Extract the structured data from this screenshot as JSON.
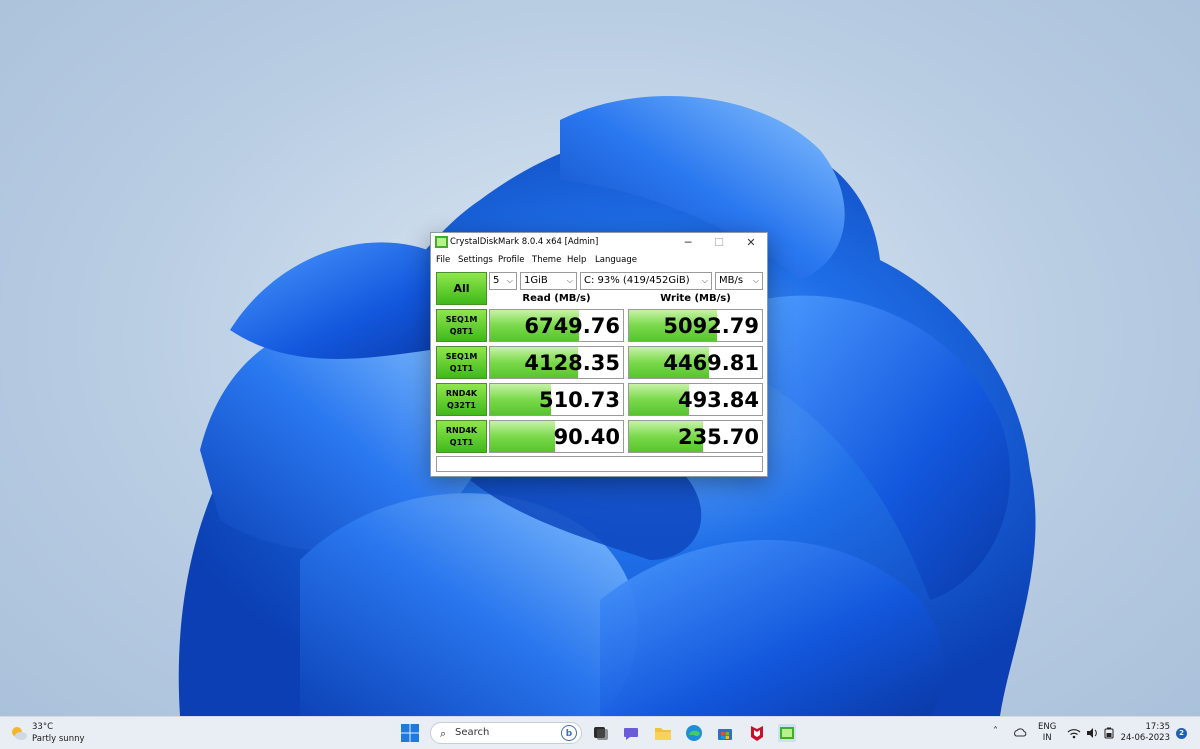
{
  "window": {
    "title": "CrystalDiskMark 8.0.4 x64 [Admin]",
    "controls": {
      "minimize": "─",
      "maximize": "☐",
      "close": "✕"
    }
  },
  "menu": [
    "File",
    "Settings",
    "Profile",
    "Theme",
    "Help",
    "Language"
  ],
  "toolbar": {
    "all_label": "All",
    "count": "5",
    "size": "1GiB",
    "drive": "C: 93% (419/452GiB)",
    "unit": "MB/s"
  },
  "columns": {
    "read": "Read (MB/s)",
    "write": "Write (MB/s)"
  },
  "tests": [
    {
      "line1": "SEQ1M",
      "line2": "Q8T1",
      "read": "6749.76",
      "write": "5092.79",
      "read_fill": 0.67,
      "write_fill": 0.66
    },
    {
      "line1": "SEQ1M",
      "line2": "Q1T1",
      "read": "4128.35",
      "write": "4469.81",
      "read_fill": 0.66,
      "write_fill": 0.6
    },
    {
      "line1": "RND4K",
      "line2": "Q32T1",
      "read": "510.73",
      "write": "493.84",
      "read_fill": 0.46,
      "write_fill": 0.45
    },
    {
      "line1": "RND4K",
      "line2": "Q1T1",
      "read": "90.40",
      "write": "235.70",
      "read_fill": 0.49,
      "write_fill": 0.56
    }
  ],
  "comment": "",
  "taskbar": {
    "weather_temp": "33°C",
    "weather_condition": "Partly sunny",
    "search_label": "Search",
    "lang_top": "ENG",
    "lang_bottom": "IN",
    "time": "17:35",
    "date": "24-06-2023",
    "notifications": "2"
  }
}
